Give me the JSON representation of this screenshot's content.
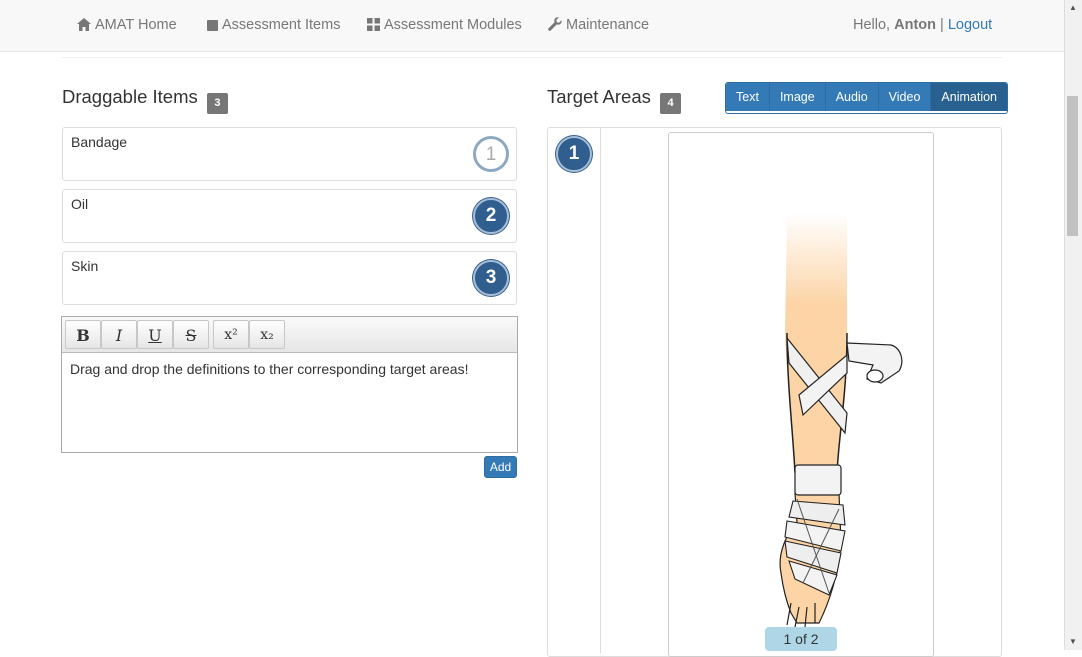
{
  "navbar": {
    "links": [
      {
        "label": "AMAT Home",
        "icon": "home-icon"
      },
      {
        "label": "Assessment Items",
        "icon": "stop-square-icon"
      },
      {
        "label": "Assessment Modules",
        "icon": "grid-icon"
      },
      {
        "label": "Maintenance",
        "icon": "wrench-icon"
      }
    ],
    "greeting": "Hello,",
    "username": "Anton",
    "separator": "|",
    "logout": "Logout"
  },
  "draggable": {
    "title": "Draggable Items",
    "count": "3",
    "items": [
      {
        "label": "Bandage",
        "number": "1"
      },
      {
        "label": "Oil",
        "number": "2"
      },
      {
        "label": "Skin",
        "number": "3"
      }
    ]
  },
  "editor": {
    "toolbar": {
      "bold": "B",
      "italic": "I",
      "underline": "U",
      "strike": "S",
      "superscript": "x²",
      "subscript": "x₂"
    },
    "content": "Drag and drop the definitions to ther corresponding target areas!",
    "add_label": "Add"
  },
  "target": {
    "title": "Target Areas",
    "count": "4",
    "media_buttons": [
      "Text",
      "Image",
      "Audio",
      "Video",
      "Animation"
    ],
    "active_media": "Animation",
    "area_number": "1",
    "pager": "1 of 2"
  },
  "colors": {
    "primary": "#337ab7",
    "primary_active": "#286090",
    "circle_fill": "#2f5e8f",
    "badge": "#777777",
    "pager_bg": "#aed6e6",
    "skin": "#fcd4a6"
  }
}
